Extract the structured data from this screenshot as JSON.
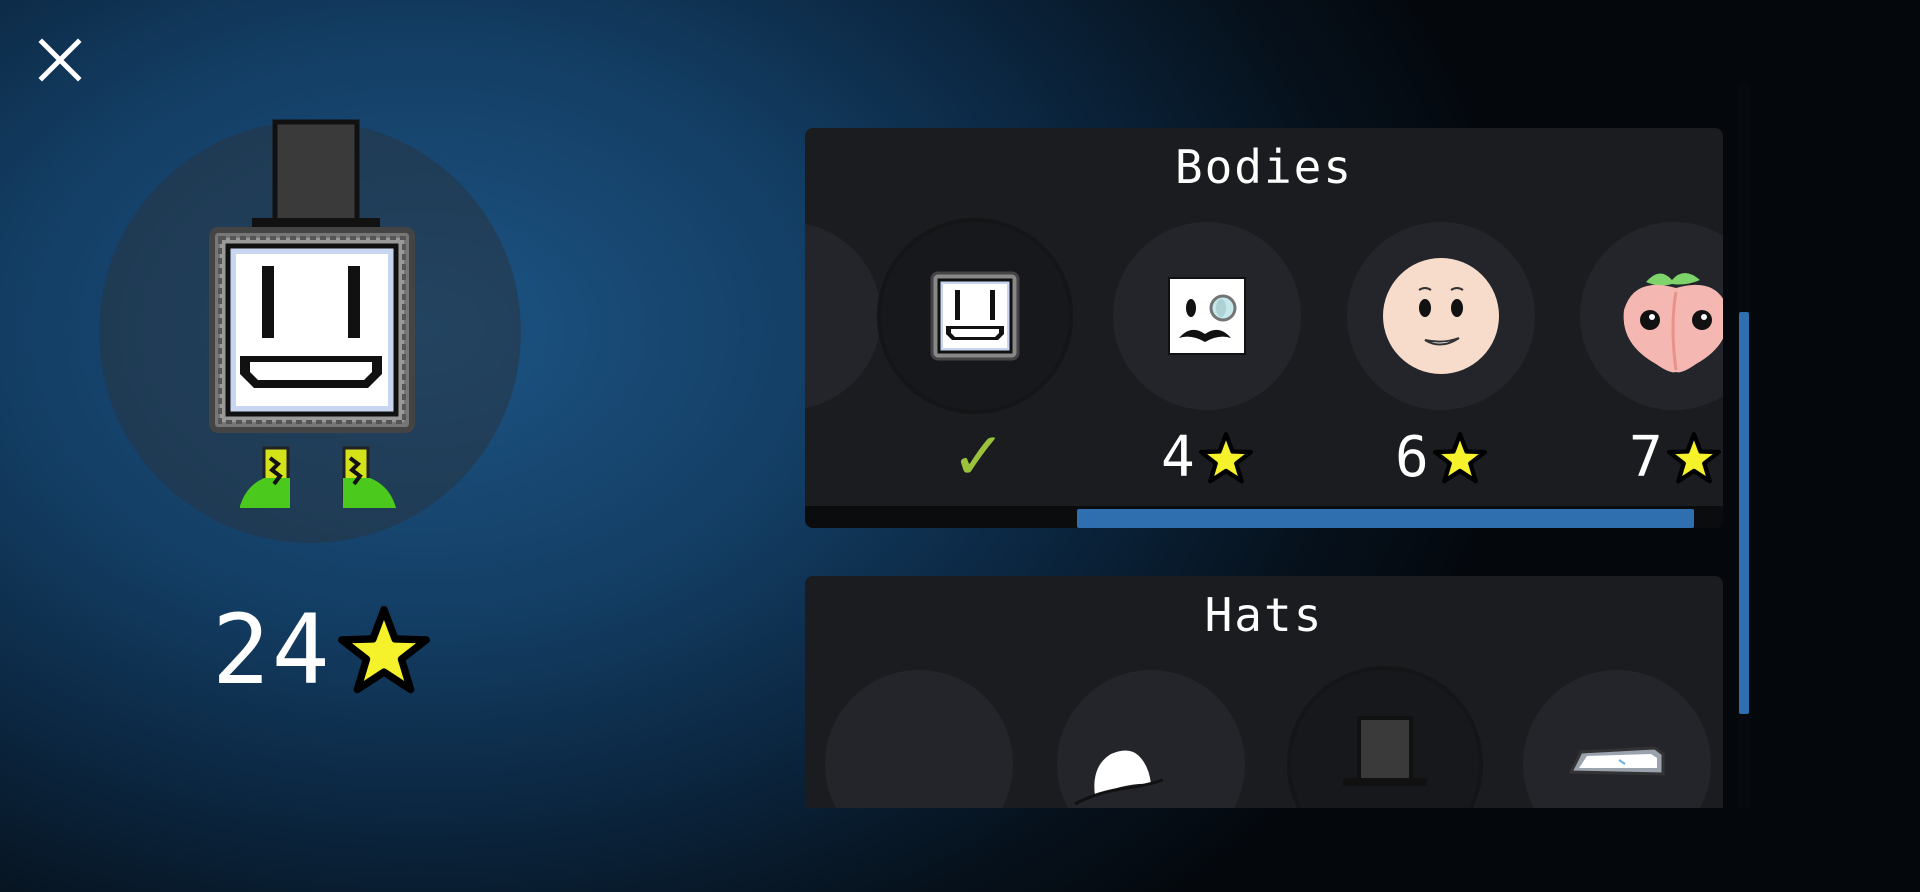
{
  "window": {
    "close_icon": "close-icon"
  },
  "player": {
    "star_total": "24",
    "star_icon": "star-icon",
    "equipped_body": "robot",
    "equipped_hat": "top-hat",
    "equipped_shoes": "green-sneakers"
  },
  "sections": {
    "bodies": {
      "title": "Bodies",
      "items": [
        {
          "name": "partial-body",
          "status": ""
        },
        {
          "name": "robot-body",
          "status": "owned",
          "mark": "✓"
        },
        {
          "name": "monocle-body",
          "price": "4"
        },
        {
          "name": "face-body",
          "price": "6"
        },
        {
          "name": "peach-body",
          "price": "7"
        }
      ],
      "scroll_position": 0.3
    },
    "hats": {
      "title": "Hats",
      "items": [
        {
          "name": "no-hat"
        },
        {
          "name": "cap-hat"
        },
        {
          "name": "top-hat"
        },
        {
          "name": "helmet-hat"
        }
      ]
    }
  },
  "page_scroll_position": 0.35,
  "colors": {
    "accent": "#2f6faf",
    "star": "#f5f12a",
    "check": "#9ac23c",
    "panel": "#1a1c1f"
  }
}
